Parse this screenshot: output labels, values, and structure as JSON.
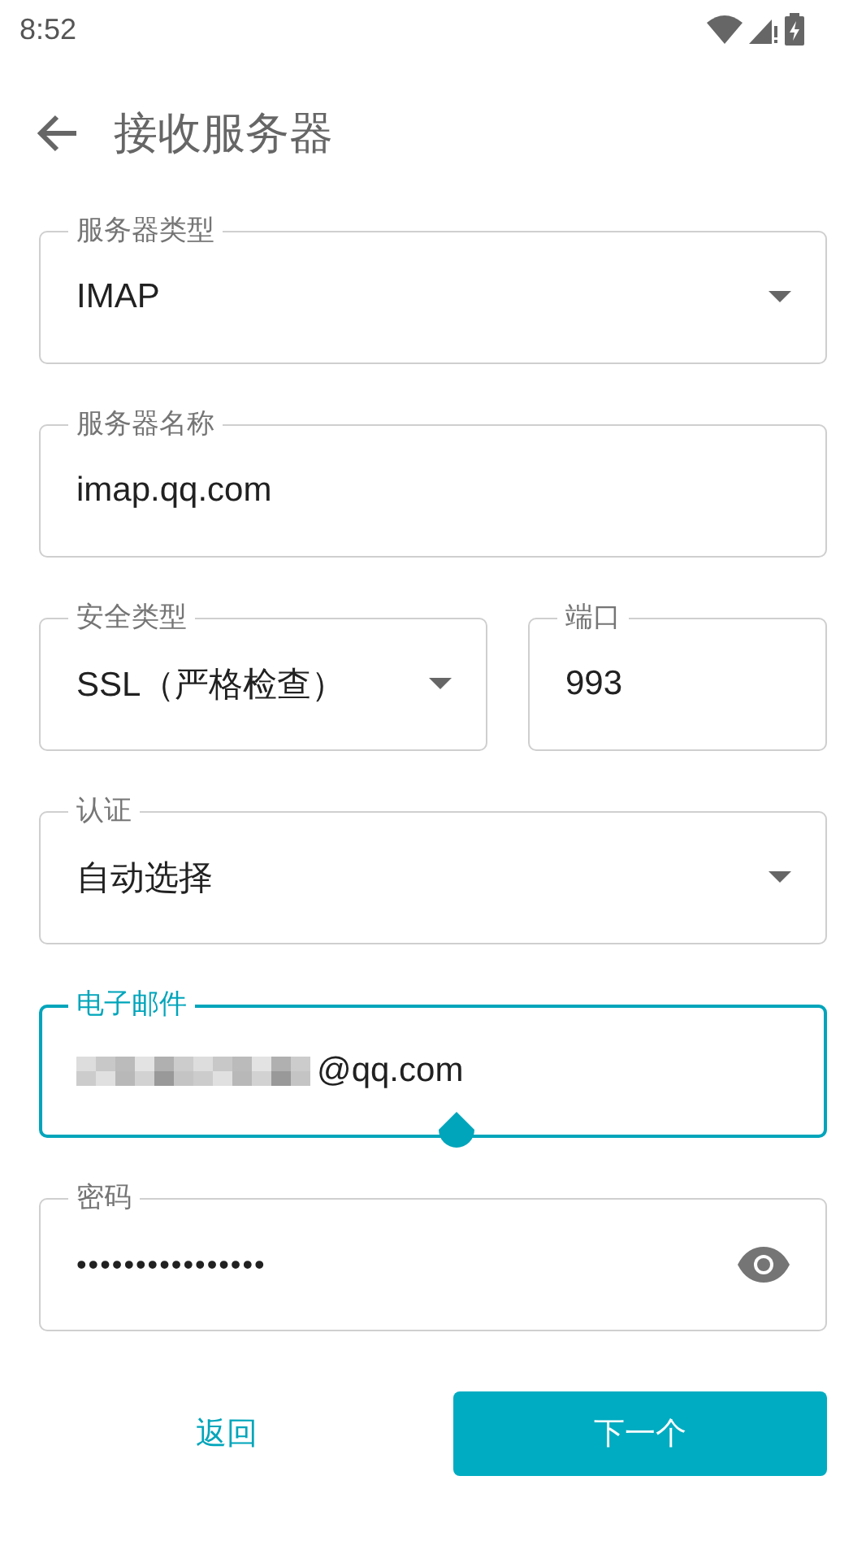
{
  "status_bar": {
    "time": "8:52"
  },
  "toolbar": {
    "title": "接收服务器"
  },
  "rows": [
    [
      {
        "kind": "select",
        "label": "服务器类型",
        "value": "IMAP",
        "focused": false
      }
    ],
    [
      {
        "kind": "text",
        "label": "服务器名称",
        "value": "imap.qq.com",
        "focused": false
      }
    ],
    [
      {
        "kind": "select",
        "label": "安全类型",
        "value": "SSL（严格检查）",
        "focused": false
      },
      {
        "kind": "text",
        "label": "端口",
        "value": "993",
        "focused": false
      }
    ],
    [
      {
        "kind": "select",
        "label": "认证",
        "value": "自动选择",
        "focused": false
      }
    ],
    [
      {
        "kind": "text",
        "label": "电子邮件",
        "value": "@qq.com",
        "focused": true,
        "obscured_prefix": true
      }
    ],
    [
      {
        "kind": "password",
        "label": "密码",
        "value": "••••••••••••••••",
        "focused": false
      }
    ]
  ],
  "buttons": [
    {
      "label": "返回",
      "kind": "text"
    },
    {
      "label": "下一个",
      "kind": "filled"
    }
  ]
}
